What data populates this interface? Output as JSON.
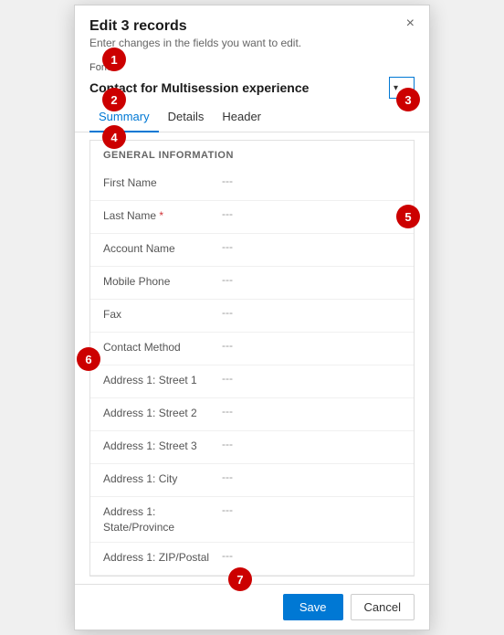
{
  "dialog": {
    "title": "Edit 3 records",
    "subtitle": "Enter changes in the fields you want to edit.",
    "close_label": "×",
    "form_label": "Form",
    "form_name": "Contact for Multisession experience",
    "dropdown_arrow": "▾"
  },
  "tabs": [
    {
      "label": "Summary",
      "active": true
    },
    {
      "label": "Details",
      "active": false
    },
    {
      "label": "Header",
      "active": false
    }
  ],
  "section": {
    "title": "GENERAL INFORMATION"
  },
  "fields": [
    {
      "label": "First Name",
      "required": false,
      "value": "---"
    },
    {
      "label": "Last Name",
      "required": true,
      "value": "---"
    },
    {
      "label": "Account Name",
      "required": false,
      "value": "---"
    },
    {
      "label": "Mobile Phone",
      "required": false,
      "value": "---"
    },
    {
      "label": "Fax",
      "required": false,
      "value": "---"
    },
    {
      "label": "Contact Method",
      "required": false,
      "value": "---"
    },
    {
      "label": "Address 1: Street 1",
      "required": false,
      "value": "---"
    },
    {
      "label": "Address 1: Street 2",
      "required": false,
      "value": "---"
    },
    {
      "label": "Address 1: Street 3",
      "required": false,
      "value": "---"
    },
    {
      "label": "Address 1: City",
      "required": false,
      "value": "---"
    },
    {
      "label": "Address 1: State/Province",
      "required": false,
      "value": "---"
    },
    {
      "label": "Address 1: ZIP/Postal",
      "required": false,
      "value": "---"
    }
  ],
  "footer": {
    "save_label": "Save",
    "cancel_label": "Cancel"
  },
  "annotations": [
    {
      "id": 1,
      "label": "1"
    },
    {
      "id": 2,
      "label": "2"
    },
    {
      "id": 3,
      "label": "3"
    },
    {
      "id": 4,
      "label": "4"
    },
    {
      "id": 5,
      "label": "5"
    },
    {
      "id": 6,
      "label": "6"
    },
    {
      "id": 7,
      "label": "7"
    }
  ]
}
